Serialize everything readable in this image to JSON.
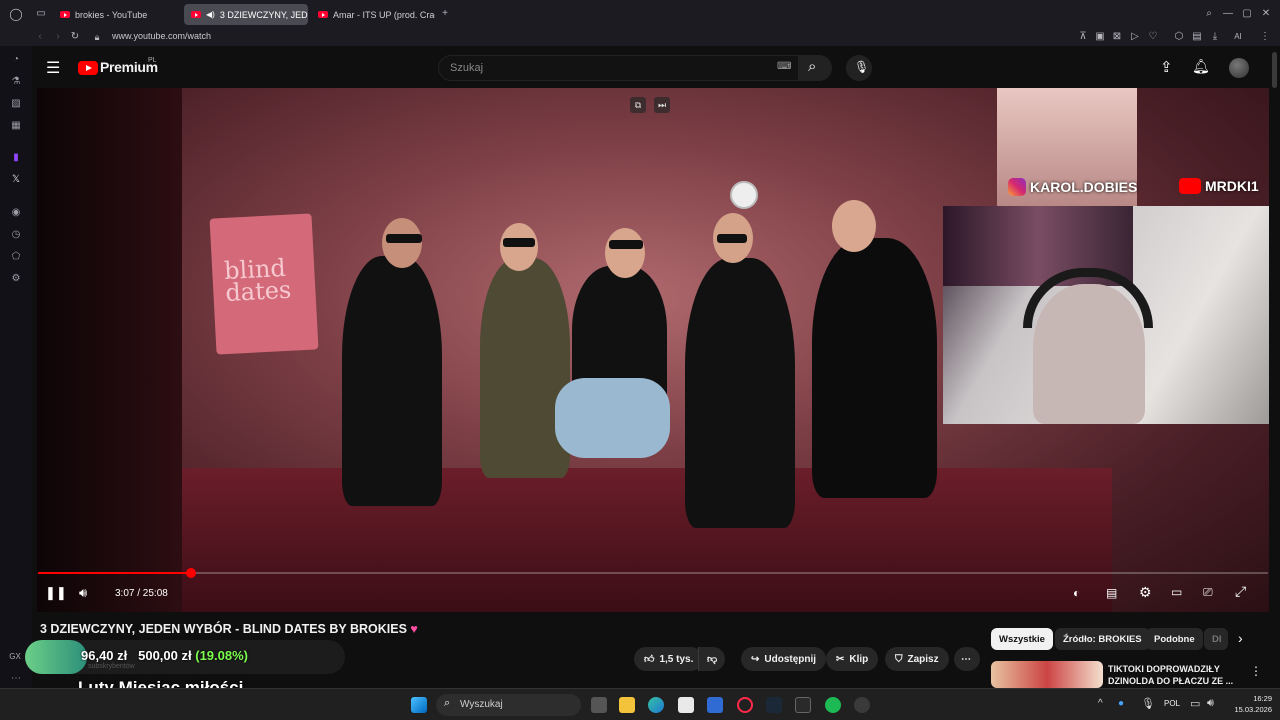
{
  "browser": {
    "tabs": [
      {
        "label": "brokies - YouTube",
        "active": false
      },
      {
        "label": "3 DZIEWCZYNY, JED",
        "active": true
      },
      {
        "label": "Amar - ITS UP (prod. Crac",
        "active": false
      }
    ],
    "url": "www.youtube.com/watch",
    "ai_label": "AI",
    "sidebar_label": "GX"
  },
  "youtube": {
    "logo": "Premium",
    "logo_badge": "PL",
    "search_placeholder": "Szukaj"
  },
  "video": {
    "overlay_instagram": "KAROL.DOBIES",
    "overlay_youtube": "MRDKI1",
    "sign_text": "blind dates",
    "time": "3:07 / 25:08",
    "progress": 0.124,
    "title": "3 DZIEWCZYNY, JEDEN WYBÓR - BLIND DATES BY BROKIES"
  },
  "actions": {
    "likes": "1,5 tys.",
    "share": "Udostępnij",
    "clip": "Klip",
    "save": "Zapisz"
  },
  "chips": [
    "Wszystkie",
    "Źródło: BROKIES",
    "Podobne",
    "Dl"
  ],
  "recommended": {
    "title_line1": "TIKTOKI DOPROWADZIŁY",
    "title_line2": "DZINOLDA DO PŁACZU ZE ..."
  },
  "stream_overlay": {
    "amount": "96,40 zł",
    "goal": "500,00 zł",
    "percent": "(19.08%)",
    "subtitle": "Luty Miesiąc miłości",
    "faint_text": "subskrybentów"
  },
  "taskbar": {
    "search_placeholder": "Wyszukaj",
    "language": "POL",
    "time": "16:29",
    "date": "15.03.2026"
  },
  "colors": {
    "accent": "#ff0000",
    "money_green": "#7cfc4e",
    "bg": "#0f0f0f"
  }
}
